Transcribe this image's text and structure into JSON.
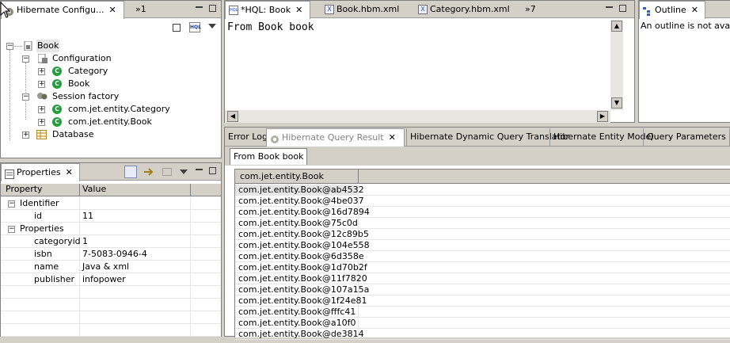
{
  "left_top": {
    "tab_title": "Hibernate Configu...",
    "overflow": "»1",
    "tree": [
      {
        "label": "Book",
        "level": 0,
        "icon": "config-file-icon",
        "expanded": true
      },
      {
        "label": "Configuration",
        "level": 1,
        "icon": "config-icon",
        "expanded": true
      },
      {
        "label": "Category",
        "level": 2,
        "icon": "class-icon",
        "expanded": false
      },
      {
        "label": "Book",
        "level": 2,
        "icon": "class-icon",
        "expanded": false
      },
      {
        "label": "Session factory",
        "level": 1,
        "icon": "session-factory-icon",
        "expanded": true
      },
      {
        "label": "com.jet.entity.Category",
        "level": 2,
        "icon": "class-icon",
        "expanded": false
      },
      {
        "label": "com.jet.entity.Book",
        "level": 2,
        "icon": "class-icon",
        "expanded": false
      },
      {
        "label": "Database",
        "level": 1,
        "icon": "database-icon",
        "expanded": false
      }
    ]
  },
  "properties": {
    "tab_title": "Properties",
    "col_property": "Property",
    "col_value": "Value",
    "rows": [
      {
        "name": "Identifier",
        "value": "",
        "group": true
      },
      {
        "name": "id",
        "value": "11",
        "group": false
      },
      {
        "name": "Properties",
        "value": "",
        "group": true
      },
      {
        "name": "categoryid",
        "value": "1",
        "group": false
      },
      {
        "name": "isbn",
        "value": "7-5083-0946-4",
        "group": false
      },
      {
        "name": "name",
        "value": "Java & xml",
        "group": false
      },
      {
        "name": "publisher",
        "value": "infopower",
        "group": false
      }
    ]
  },
  "editor": {
    "tabs": [
      {
        "label": "*HQL: Book",
        "active": true
      },
      {
        "label": "Book.hbm.xml",
        "active": false
      },
      {
        "label": "Category.hbm.xml",
        "active": false
      }
    ],
    "overflow": "»7",
    "query_text": "From Book book"
  },
  "outline": {
    "tab_title": "Outline",
    "message": "An outline is not available."
  },
  "bottom": {
    "tabs": [
      {
        "label": "Error Log",
        "active": false
      },
      {
        "label": "Hibernate Query Result",
        "active": true
      },
      {
        "label": "Hibernate Dynamic Query Translator",
        "active": false
      },
      {
        "label": "Hibernate Entity Model",
        "active": false
      },
      {
        "label": "Query Parameters",
        "active": false
      }
    ],
    "result_tab": "From Book book",
    "column_header": "com.jet.entity.Book",
    "rows": [
      "com.jet.entity.Book@ab4532",
      "com.jet.entity.Book@4be037",
      "com.jet.entity.Book@16d7894",
      "com.jet.entity.Book@75c0d",
      "com.jet.entity.Book@12c89b5",
      "com.jet.entity.Book@104e558",
      "com.jet.entity.Book@6d358e",
      "com.jet.entity.Book@1d70b2f",
      "com.jet.entity.Book@11f7820",
      "com.jet.entity.Book@107a15a",
      "com.jet.entity.Book@1f24e81",
      "com.jet.entity.Book@fffc41",
      "com.jet.entity.Book@a10f0",
      "com.jet.entity.Book@de3814"
    ]
  }
}
